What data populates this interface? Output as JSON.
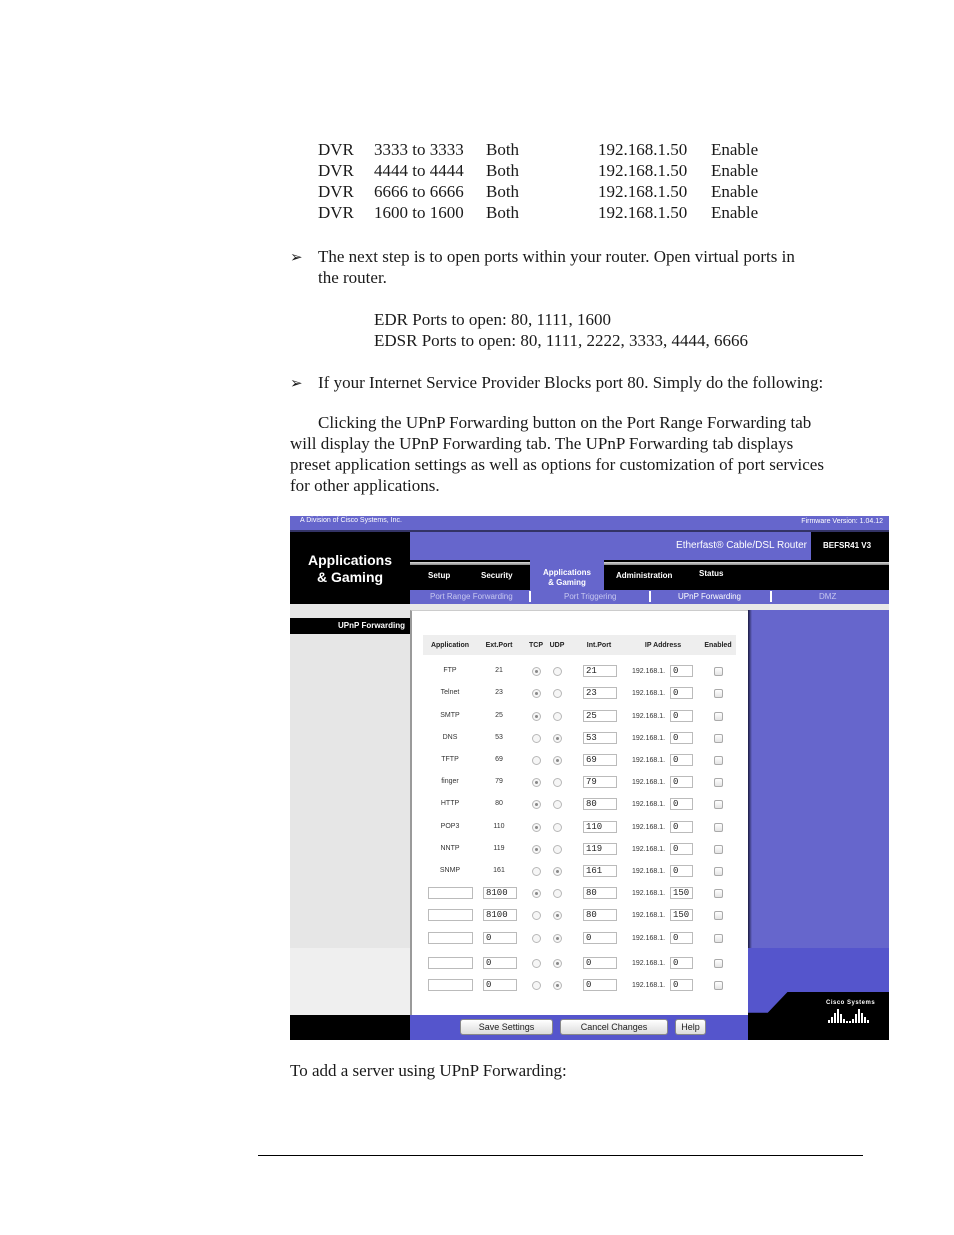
{
  "dvr_table": [
    {
      "name": "DVR",
      "range": "3333 to 3333",
      "protocol": "Both",
      "ip": "192.168.1.50",
      "status": "Enable"
    },
    {
      "name": "DVR",
      "range": "4444 to 4444",
      "protocol": "Both",
      "ip": "192.168.1.50",
      "status": "Enable"
    },
    {
      "name": "DVR",
      "range": "6666 to 6666",
      "protocol": "Both",
      "ip": "192.168.1.50",
      "status": "Enable"
    },
    {
      "name": "DVR",
      "range": "1600 to 1600",
      "protocol": "Both",
      "ip": "192.168.1.50",
      "status": "Enable"
    }
  ],
  "bullets": {
    "glyph": "➢",
    "step1_line1": "The next step is to open ports within your router. Open virtual ports in",
    "step1_line2": "the router.",
    "edr_ports": "EDR Ports to open: 80, 1111, 1600",
    "edsr_ports": "EDSR Ports to open: 80, 1111, 2222, 3333, 4444, 6666",
    "step2": "If your Internet Service Provider Blocks port 80. Simply do the following:"
  },
  "paragraph": {
    "line1": "Clicking the UPnP Forwarding button on the Port Range Forwarding tab",
    "line2": "will display the UPnP Forwarding tab. The UPnP Forwarding tab displays",
    "line3": "preset application settings as well as options for customization of port services",
    "line4": "for other applications."
  },
  "footer_text": "To add a server using UPnP Forwarding:",
  "router": {
    "division": "A Division of Cisco Systems, Inc.",
    "firmware": "Firmware Version: 1.04.12",
    "section_title_line1": "Applications",
    "section_title_line2": "& Gaming",
    "product_name": "Etherfast® Cable/DSL Router",
    "model": "BEFSR41 V3",
    "tabs": {
      "setup": "Setup",
      "security": "Security",
      "apps_line1": "Applications",
      "apps_line2": "& Gaming",
      "administration": "Administration",
      "status": "Status"
    },
    "subtabs": {
      "port_range": "Port Range Forwarding",
      "port_triggering": "Port Triggering",
      "upnp": "UPnP Forwarding",
      "dmz": "DMZ"
    },
    "left_label": "UPnP Forwarding",
    "columns": {
      "application": "Application",
      "ext_port": "Ext.Port",
      "tcp": "TCP",
      "udp": "UDP",
      "int_port": "Int.Port",
      "ip_address": "IP Address",
      "enabled": "Enabled"
    },
    "ip_prefix": "192.168.1.",
    "rows": [
      {
        "app": "FTP",
        "ext": "21",
        "proto": "TCP",
        "int": "21",
        "ip_last": "0",
        "enabled": false
      },
      {
        "app": "Telnet",
        "ext": "23",
        "proto": "TCP",
        "int": "23",
        "ip_last": "0",
        "enabled": false
      },
      {
        "app": "SMTP",
        "ext": "25",
        "proto": "TCP",
        "int": "25",
        "ip_last": "0",
        "enabled": false
      },
      {
        "app": "DNS",
        "ext": "53",
        "proto": "UDP",
        "int": "53",
        "ip_last": "0",
        "enabled": false
      },
      {
        "app": "TFTP",
        "ext": "69",
        "proto": "UDP",
        "int": "69",
        "ip_last": "0",
        "enabled": false
      },
      {
        "app": "finger",
        "ext": "79",
        "proto": "TCP",
        "int": "79",
        "ip_last": "0",
        "enabled": false
      },
      {
        "app": "HTTP",
        "ext": "80",
        "proto": "TCP",
        "int": "80",
        "ip_last": "0",
        "enabled": false
      },
      {
        "app": "POP3",
        "ext": "110",
        "proto": "TCP",
        "int": "110",
        "ip_last": "0",
        "enabled": false
      },
      {
        "app": "NNTP",
        "ext": "119",
        "proto": "TCP",
        "int": "119",
        "ip_last": "0",
        "enabled": false
      },
      {
        "app": "SNMP",
        "ext": "161",
        "proto": "UDP",
        "int": "161",
        "ip_last": "0",
        "enabled": false
      },
      {
        "app": "",
        "ext": "8100",
        "proto": "TCP",
        "int": "80",
        "ip_last": "150",
        "enabled": false,
        "editable": true
      },
      {
        "app": "",
        "ext": "8100",
        "proto": "UDP",
        "int": "80",
        "ip_last": "150",
        "enabled": false,
        "editable": true
      },
      {
        "app": "",
        "ext": "0",
        "proto": "UDP",
        "int": "0",
        "ip_last": "0",
        "enabled": false,
        "editable": true
      },
      {
        "app": "",
        "ext": "0",
        "proto": "UDP",
        "int": "0",
        "ip_last": "0",
        "enabled": false,
        "editable": true
      },
      {
        "app": "",
        "ext": "0",
        "proto": "UDP",
        "int": "0",
        "ip_last": "0",
        "enabled": false,
        "editable": true
      }
    ],
    "buttons": {
      "save": "Save Settings",
      "cancel": "Cancel Changes",
      "help": "Help"
    },
    "logo_text": "Cisco Systems",
    "colors": {
      "brand_purple": "#6666cc",
      "footer_purple": "#5555cc",
      "black": "#000000"
    }
  }
}
